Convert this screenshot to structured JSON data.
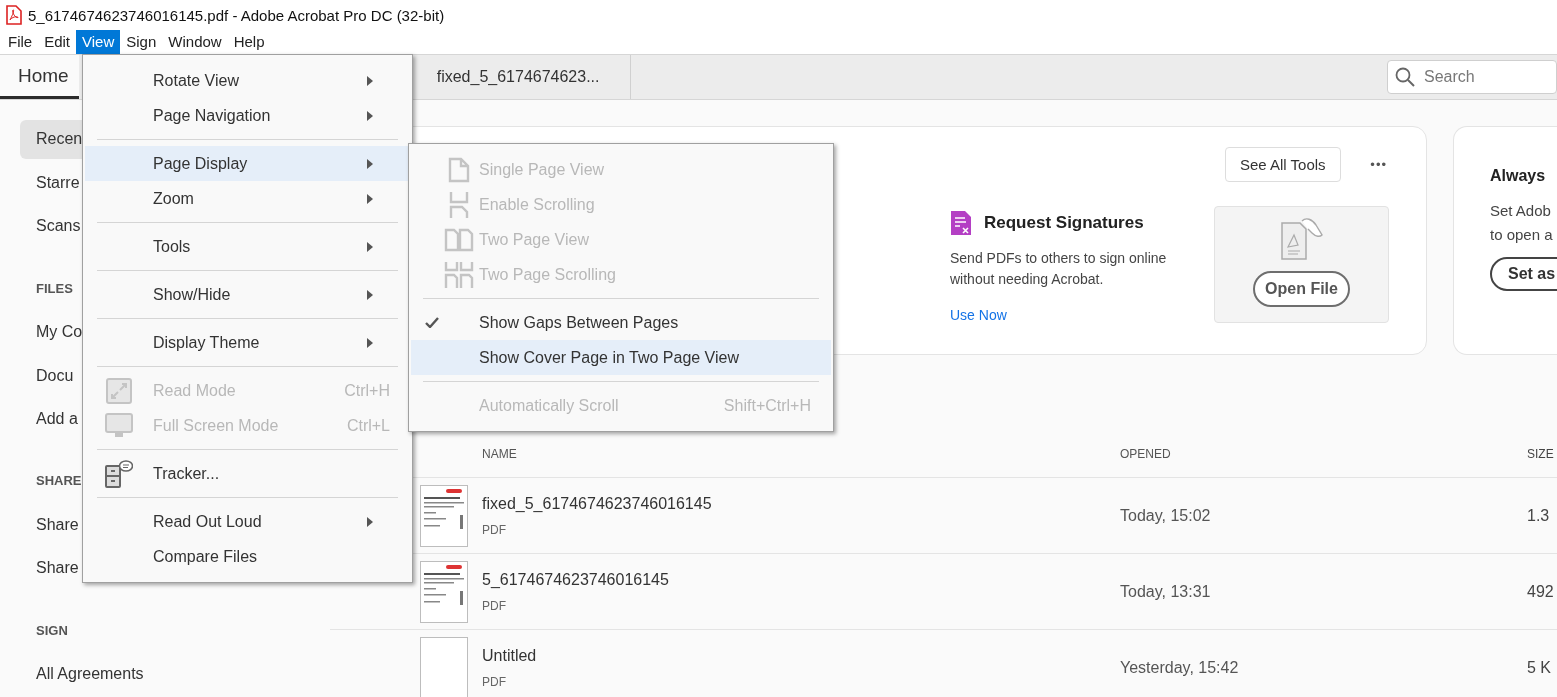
{
  "window": {
    "title": "5_6174674623746016145.pdf - Adobe Acrobat Pro DC (32-bit)"
  },
  "menubar": [
    {
      "label": "File",
      "selected": false
    },
    {
      "label": "Edit",
      "selected": false
    },
    {
      "label": "View",
      "selected": true
    },
    {
      "label": "Sign",
      "selected": false
    },
    {
      "label": "Window",
      "selected": false
    },
    {
      "label": "Help",
      "selected": false
    }
  ],
  "tabs": [
    {
      "label": "Home",
      "selected": true
    },
    {
      "label": "fixed_5_6174674623...",
      "selected": false
    }
  ],
  "search": {
    "placeholder": "Search"
  },
  "sidebar": [
    {
      "kind": "item",
      "label": "Recen",
      "selected": true
    },
    {
      "kind": "item",
      "label": "Starre",
      "selected": false
    },
    {
      "kind": "item",
      "label": "Scans",
      "selected": false
    },
    {
      "kind": "heading",
      "label": "FILES"
    },
    {
      "kind": "item",
      "label": "My Co",
      "selected": false
    },
    {
      "kind": "item",
      "label": "Docu",
      "selected": false
    },
    {
      "kind": "item",
      "label": "Add a",
      "selected": false
    },
    {
      "kind": "heading",
      "label": "SHARE"
    },
    {
      "kind": "item",
      "label": "Share",
      "selected": false
    },
    {
      "kind": "item",
      "label": "Share",
      "selected": false
    },
    {
      "kind": "heading",
      "label": "SIGN"
    },
    {
      "kind": "item",
      "label": "All Agreements",
      "selected": false
    }
  ],
  "tools_card": {
    "see_all": "See All Tools",
    "more": "•••",
    "tool": {
      "title": "Request Signatures",
      "description": "Send PDFs to others to sign online without needing Acrobat.",
      "link": "Use Now"
    },
    "open_file": "Open File"
  },
  "default_card": {
    "title": "Always",
    "lines": [
      "Set Adob",
      "to open a"
    ],
    "button": "Set as"
  },
  "files": {
    "columns": [
      "NAME",
      "OPENED",
      "SIZE"
    ],
    "rows": [
      {
        "name": "fixed_5_6174674623746016145",
        "type": "PDF",
        "opened": "Today, 15:02",
        "size": "1.3",
        "blank": false
      },
      {
        "name": "5_6174674623746016145",
        "type": "PDF",
        "opened": "Today, 13:31",
        "size": "492",
        "blank": false
      },
      {
        "name": "Untitled",
        "type": "PDF",
        "opened": "Yesterday, 15:42",
        "size": "5 K",
        "blank": true
      }
    ]
  },
  "view_menu": [
    {
      "kind": "submenu",
      "label": "Rotate View",
      "selected": false,
      "disabled": false
    },
    {
      "kind": "submenu",
      "label": "Page Navigation",
      "selected": false,
      "disabled": false
    },
    {
      "kind": "separator"
    },
    {
      "kind": "submenu",
      "label": "Page Display",
      "selected": true,
      "disabled": false
    },
    {
      "kind": "submenu",
      "label": "Zoom",
      "selected": false,
      "disabled": false
    },
    {
      "kind": "separator"
    },
    {
      "kind": "submenu",
      "label": "Tools",
      "selected": false,
      "disabled": false
    },
    {
      "kind": "separator"
    },
    {
      "kind": "submenu",
      "label": "Show/Hide",
      "selected": false,
      "disabled": false
    },
    {
      "kind": "separator"
    },
    {
      "kind": "submenu",
      "label": "Display Theme",
      "selected": false,
      "disabled": false
    },
    {
      "kind": "separator"
    },
    {
      "kind": "command",
      "label": "Read Mode",
      "shortcut": "Ctrl+H",
      "selected": false,
      "disabled": true
    },
    {
      "kind": "command",
      "label": "Full Screen Mode",
      "shortcut": "Ctrl+L",
      "selected": false,
      "disabled": true
    },
    {
      "kind": "separator"
    },
    {
      "kind": "command",
      "label": "Tracker...",
      "selected": false,
      "disabled": false
    },
    {
      "kind": "separator"
    },
    {
      "kind": "submenu",
      "label": "Read Out Loud",
      "selected": false,
      "disabled": false
    },
    {
      "kind": "command",
      "label": "Compare Files",
      "selected": false,
      "disabled": false
    }
  ],
  "page_display_menu": [
    {
      "kind": "command",
      "label": "Single Page View",
      "selected": false,
      "disabled": true,
      "checked": false
    },
    {
      "kind": "command",
      "label": "Enable Scrolling",
      "selected": false,
      "disabled": true,
      "checked": false
    },
    {
      "kind": "command",
      "label": "Two Page View",
      "selected": false,
      "disabled": true,
      "checked": false
    },
    {
      "kind": "command",
      "label": "Two Page Scrolling",
      "selected": false,
      "disabled": true,
      "checked": false
    },
    {
      "kind": "separator"
    },
    {
      "kind": "command",
      "label": "Show Gaps Between Pages",
      "selected": false,
      "disabled": false,
      "checked": true
    },
    {
      "kind": "command",
      "label": "Show Cover Page in Two Page View",
      "selected": true,
      "disabled": false,
      "checked": false
    },
    {
      "kind": "separator"
    },
    {
      "kind": "command",
      "label": "Automatically Scroll",
      "shortcut": "Shift+Ctrl+H",
      "selected": false,
      "disabled": true,
      "checked": false
    }
  ]
}
